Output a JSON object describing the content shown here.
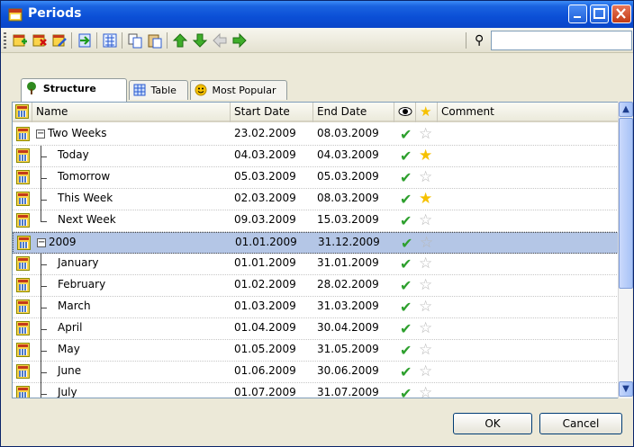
{
  "window": {
    "title": "Periods"
  },
  "toolbar": {
    "icons": [
      "add-period-icon",
      "delete-period-icon",
      "edit-period-icon",
      "import-icon",
      "group-icon",
      "copy-icon",
      "paste-icon",
      "move-up-icon",
      "move-down-icon",
      "move-left-icon",
      "move-right-icon"
    ],
    "search_value": ""
  },
  "tabs": [
    {
      "label": "Structure",
      "icon": "tree-icon",
      "active": true
    },
    {
      "label": "Table",
      "icon": "table-icon",
      "active": false
    },
    {
      "label": "Most Popular",
      "icon": "smiley-icon",
      "active": false
    }
  ],
  "columns": {
    "name": "Name",
    "start": "Start Date",
    "end": "End Date",
    "comment": "Comment"
  },
  "rows": [
    {
      "name": "Two Weeks",
      "start": "23.02.2009",
      "end": "08.03.2009",
      "popular": false,
      "level": 0,
      "expander": "−"
    },
    {
      "name": "Today",
      "start": "04.03.2009",
      "end": "04.03.2009",
      "popular": true,
      "level": 1
    },
    {
      "name": "Tomorrow",
      "start": "05.03.2009",
      "end": "05.03.2009",
      "popular": false,
      "level": 1
    },
    {
      "name": "This Week",
      "start": "02.03.2009",
      "end": "08.03.2009",
      "popular": true,
      "level": 1
    },
    {
      "name": "Next Week",
      "start": "09.03.2009",
      "end": "15.03.2009",
      "popular": false,
      "level": 1,
      "last": true
    },
    {
      "name": "2009",
      "start": "01.01.2009",
      "end": "31.12.2009",
      "popular": false,
      "level": 0,
      "expander": "−",
      "selected": true
    },
    {
      "name": "January",
      "start": "01.01.2009",
      "end": "31.01.2009",
      "popular": false,
      "level": 1
    },
    {
      "name": "February",
      "start": "01.02.2009",
      "end": "28.02.2009",
      "popular": false,
      "level": 1
    },
    {
      "name": "March",
      "start": "01.03.2009",
      "end": "31.03.2009",
      "popular": false,
      "level": 1
    },
    {
      "name": "April",
      "start": "01.04.2009",
      "end": "30.04.2009",
      "popular": false,
      "level": 1
    },
    {
      "name": "May",
      "start": "01.05.2009",
      "end": "31.05.2009",
      "popular": false,
      "level": 1
    },
    {
      "name": "June",
      "start": "01.06.2009",
      "end": "30.06.2009",
      "popular": false,
      "level": 1
    },
    {
      "name": "July",
      "start": "01.07.2009",
      "end": "31.07.2009",
      "popular": false,
      "level": 1
    }
  ],
  "buttons": {
    "ok": "OK",
    "cancel": "Cancel"
  },
  "colors": {
    "titlebar": "#0a46c8",
    "selection": "#b4c6e6",
    "check": "#2ea02e",
    "star_on": "#f6c100",
    "star_off": "#b7b7b7"
  }
}
